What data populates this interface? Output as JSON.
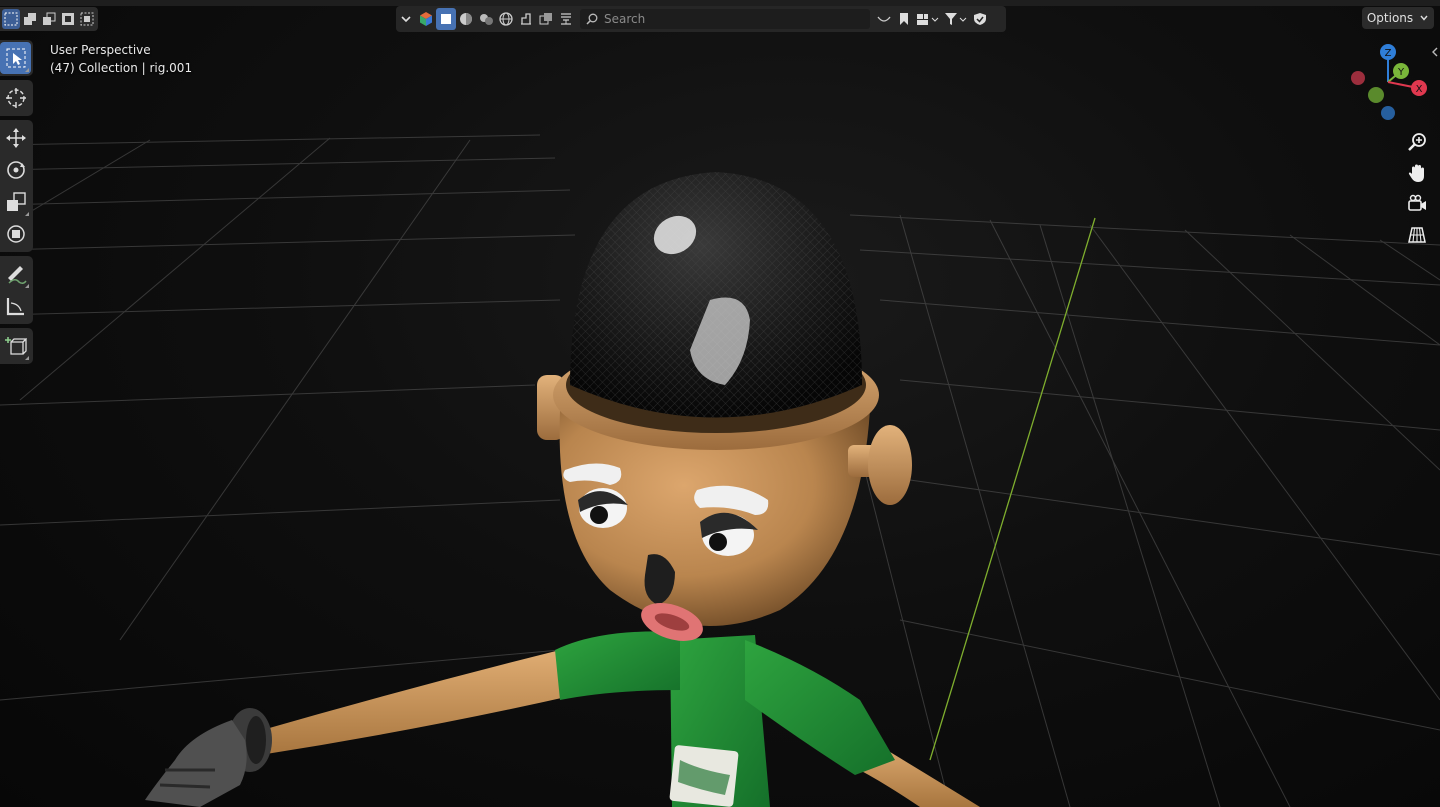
{
  "view_info": {
    "perspective": "User Perspective",
    "collection": "(47) Collection | rig.001"
  },
  "header": {
    "search_placeholder": "Search"
  },
  "options": {
    "label": "Options"
  },
  "gizmo": {
    "z_label": "Z",
    "y_label": "Y",
    "x_label": "X",
    "colors": {
      "x": "#e0384f",
      "y": "#7ab63a",
      "z": "#2f7ed8"
    }
  },
  "toolbar": {
    "tools": [
      "select-box",
      "cursor",
      "move",
      "rotate",
      "scale",
      "transform",
      "annotate",
      "measure",
      "add-cube"
    ]
  },
  "nav_tools": [
    "zoom-icon",
    "hand-pan-icon",
    "camera-icon",
    "grid-ortho-icon"
  ]
}
